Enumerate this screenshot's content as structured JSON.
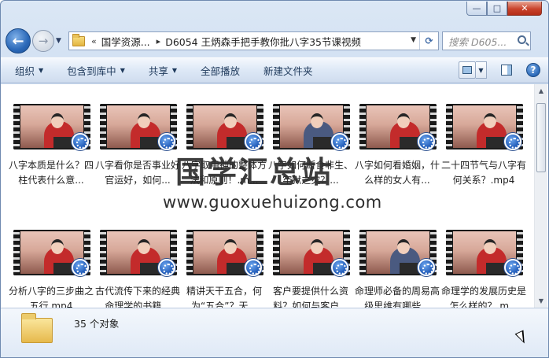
{
  "window": {
    "minimize_label": "—",
    "maximize_label": "□",
    "close_label": "✕"
  },
  "nav": {
    "back_label": "←",
    "forward_label": "→",
    "address": {
      "separator": "«",
      "crumb_parent": "国学资源...",
      "crumb_arrow": "▸",
      "crumb_current": "D6054 王炳森手把手教你批八字35节课视频"
    },
    "search_placeholder": "搜索 D605..."
  },
  "toolbar": {
    "organize": "组织",
    "include_in_library": "包含到库中",
    "share": "共享",
    "play_all": "全部播放",
    "new_folder": "新建文件夹"
  },
  "files": [
    {
      "name": "八字本质是什么？四柱代表什么意...",
      "presenter": "red"
    },
    {
      "name": "八字看你是否事业好官运好，如何...",
      "presenter": "red"
    },
    {
      "name": "八字取用神的整体方法和原则！.m...",
      "presenter": "red"
    },
    {
      "name": "八字如何断食非生、牢狱之灾？...",
      "presenter": "dark"
    },
    {
      "name": "八字如何看婚姻，什么样的女人有...",
      "presenter": "red"
    },
    {
      "name": "二十四节气与八字有何关系？.mp4",
      "presenter": "red"
    },
    {
      "name": "分析八字的三步曲之五行.mp4",
      "presenter": "red"
    },
    {
      "name": "古代流传下来的经典命理学的书籍...",
      "presenter": "red"
    },
    {
      "name": "精讲天干五合，何为“五合”？天...",
      "presenter": "red"
    },
    {
      "name": "客户要提供什么资料？如何与客户...",
      "presenter": "red"
    },
    {
      "name": "命理师必备的周易高级思维有哪些...",
      "presenter": "dark"
    },
    {
      "name": "命理学的发展历史是怎么样的？.m...",
      "presenter": "red"
    }
  ],
  "watermark": {
    "title": "国学汇总站",
    "url": "www.guoxuehuizong.com"
  },
  "details": {
    "count_text": "35 个对象"
  },
  "icons": {
    "folder": "folder-icon",
    "video_badge": "media-player-badge-icon"
  }
}
